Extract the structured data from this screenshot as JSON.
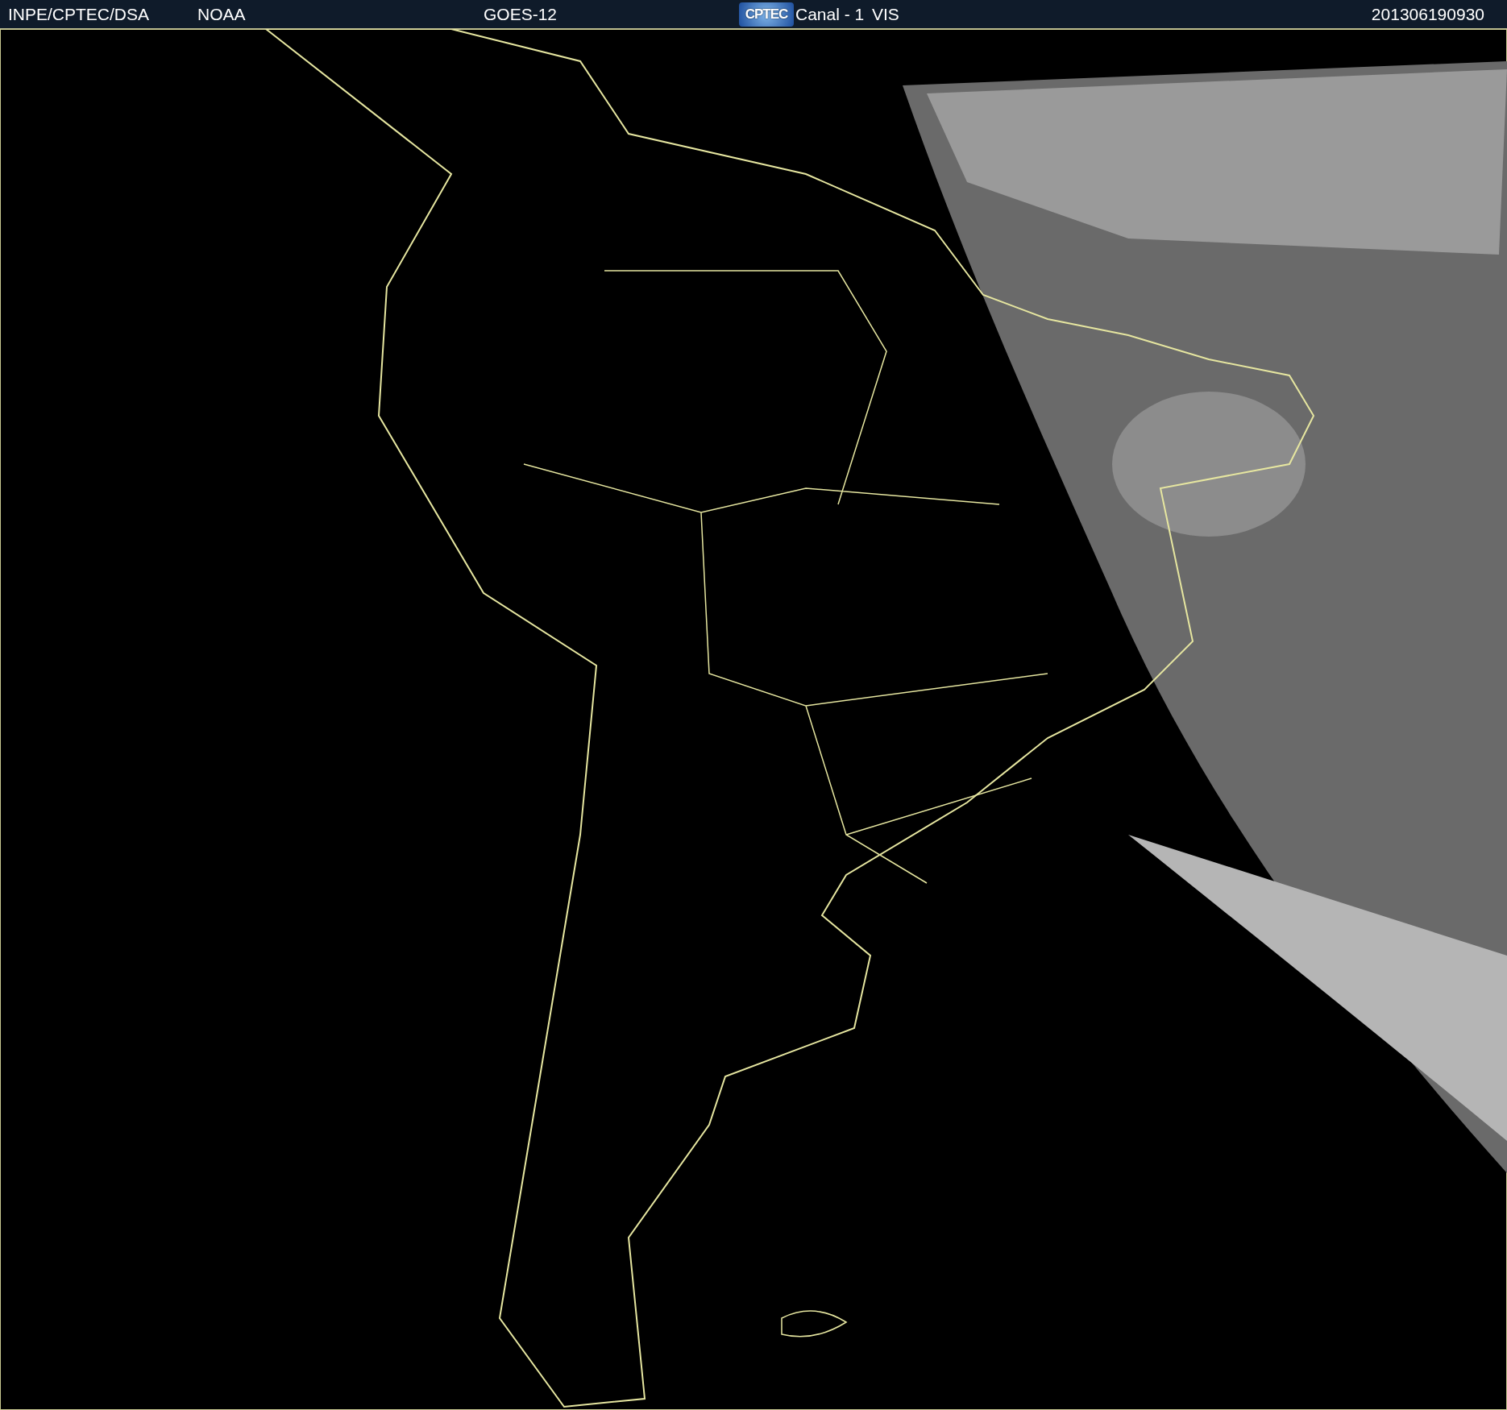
{
  "header": {
    "items": [
      {
        "kind": "text",
        "text": "INPE/CPTEC/DSA"
      },
      {
        "kind": "text",
        "text": "NOAA"
      },
      {
        "kind": "text",
        "text": "GOES-12"
      },
      {
        "kind": "logo",
        "text": "CPTEC"
      },
      {
        "kind": "text",
        "text": "Canal - 1"
      },
      {
        "kind": "text",
        "text": "VIS"
      },
      {
        "kind": "text",
        "text": "201306190930"
      }
    ]
  }
}
